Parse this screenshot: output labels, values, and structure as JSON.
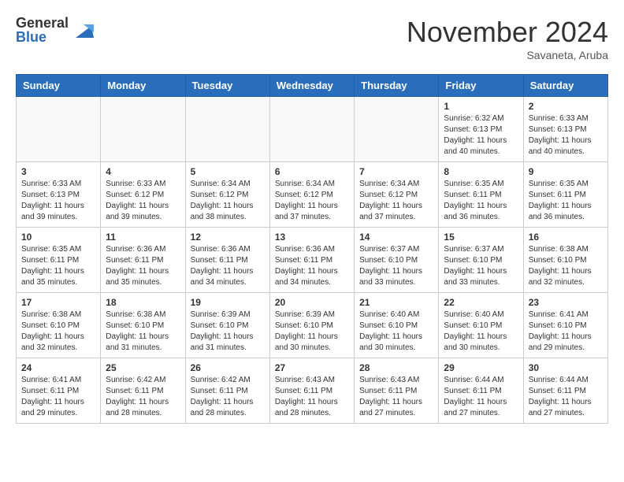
{
  "header": {
    "logo_general": "General",
    "logo_blue": "Blue",
    "month_title": "November 2024",
    "location": "Savaneta, Aruba"
  },
  "weekdays": [
    "Sunday",
    "Monday",
    "Tuesday",
    "Wednesday",
    "Thursday",
    "Friday",
    "Saturday"
  ],
  "weeks": [
    [
      {
        "day": "",
        "info": ""
      },
      {
        "day": "",
        "info": ""
      },
      {
        "day": "",
        "info": ""
      },
      {
        "day": "",
        "info": ""
      },
      {
        "day": "",
        "info": ""
      },
      {
        "day": "1",
        "info": "Sunrise: 6:32 AM\nSunset: 6:13 PM\nDaylight: 11 hours\nand 40 minutes."
      },
      {
        "day": "2",
        "info": "Sunrise: 6:33 AM\nSunset: 6:13 PM\nDaylight: 11 hours\nand 40 minutes."
      }
    ],
    [
      {
        "day": "3",
        "info": "Sunrise: 6:33 AM\nSunset: 6:13 PM\nDaylight: 11 hours\nand 39 minutes."
      },
      {
        "day": "4",
        "info": "Sunrise: 6:33 AM\nSunset: 6:12 PM\nDaylight: 11 hours\nand 39 minutes."
      },
      {
        "day": "5",
        "info": "Sunrise: 6:34 AM\nSunset: 6:12 PM\nDaylight: 11 hours\nand 38 minutes."
      },
      {
        "day": "6",
        "info": "Sunrise: 6:34 AM\nSunset: 6:12 PM\nDaylight: 11 hours\nand 37 minutes."
      },
      {
        "day": "7",
        "info": "Sunrise: 6:34 AM\nSunset: 6:12 PM\nDaylight: 11 hours\nand 37 minutes."
      },
      {
        "day": "8",
        "info": "Sunrise: 6:35 AM\nSunset: 6:11 PM\nDaylight: 11 hours\nand 36 minutes."
      },
      {
        "day": "9",
        "info": "Sunrise: 6:35 AM\nSunset: 6:11 PM\nDaylight: 11 hours\nand 36 minutes."
      }
    ],
    [
      {
        "day": "10",
        "info": "Sunrise: 6:35 AM\nSunset: 6:11 PM\nDaylight: 11 hours\nand 35 minutes."
      },
      {
        "day": "11",
        "info": "Sunrise: 6:36 AM\nSunset: 6:11 PM\nDaylight: 11 hours\nand 35 minutes."
      },
      {
        "day": "12",
        "info": "Sunrise: 6:36 AM\nSunset: 6:11 PM\nDaylight: 11 hours\nand 34 minutes."
      },
      {
        "day": "13",
        "info": "Sunrise: 6:36 AM\nSunset: 6:11 PM\nDaylight: 11 hours\nand 34 minutes."
      },
      {
        "day": "14",
        "info": "Sunrise: 6:37 AM\nSunset: 6:10 PM\nDaylight: 11 hours\nand 33 minutes."
      },
      {
        "day": "15",
        "info": "Sunrise: 6:37 AM\nSunset: 6:10 PM\nDaylight: 11 hours\nand 33 minutes."
      },
      {
        "day": "16",
        "info": "Sunrise: 6:38 AM\nSunset: 6:10 PM\nDaylight: 11 hours\nand 32 minutes."
      }
    ],
    [
      {
        "day": "17",
        "info": "Sunrise: 6:38 AM\nSunset: 6:10 PM\nDaylight: 11 hours\nand 32 minutes."
      },
      {
        "day": "18",
        "info": "Sunrise: 6:38 AM\nSunset: 6:10 PM\nDaylight: 11 hours\nand 31 minutes."
      },
      {
        "day": "19",
        "info": "Sunrise: 6:39 AM\nSunset: 6:10 PM\nDaylight: 11 hours\nand 31 minutes."
      },
      {
        "day": "20",
        "info": "Sunrise: 6:39 AM\nSunset: 6:10 PM\nDaylight: 11 hours\nand 30 minutes."
      },
      {
        "day": "21",
        "info": "Sunrise: 6:40 AM\nSunset: 6:10 PM\nDaylight: 11 hours\nand 30 minutes."
      },
      {
        "day": "22",
        "info": "Sunrise: 6:40 AM\nSunset: 6:10 PM\nDaylight: 11 hours\nand 30 minutes."
      },
      {
        "day": "23",
        "info": "Sunrise: 6:41 AM\nSunset: 6:10 PM\nDaylight: 11 hours\nand 29 minutes."
      }
    ],
    [
      {
        "day": "24",
        "info": "Sunrise: 6:41 AM\nSunset: 6:11 PM\nDaylight: 11 hours\nand 29 minutes."
      },
      {
        "day": "25",
        "info": "Sunrise: 6:42 AM\nSunset: 6:11 PM\nDaylight: 11 hours\nand 28 minutes."
      },
      {
        "day": "26",
        "info": "Sunrise: 6:42 AM\nSunset: 6:11 PM\nDaylight: 11 hours\nand 28 minutes."
      },
      {
        "day": "27",
        "info": "Sunrise: 6:43 AM\nSunset: 6:11 PM\nDaylight: 11 hours\nand 28 minutes."
      },
      {
        "day": "28",
        "info": "Sunrise: 6:43 AM\nSunset: 6:11 PM\nDaylight: 11 hours\nand 27 minutes."
      },
      {
        "day": "29",
        "info": "Sunrise: 6:44 AM\nSunset: 6:11 PM\nDaylight: 11 hours\nand 27 minutes."
      },
      {
        "day": "30",
        "info": "Sunrise: 6:44 AM\nSunset: 6:11 PM\nDaylight: 11 hours\nand 27 minutes."
      }
    ]
  ]
}
